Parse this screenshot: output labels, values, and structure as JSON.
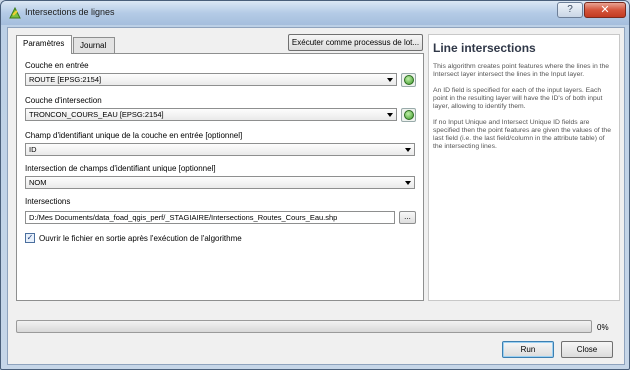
{
  "window": {
    "title": "Intersections de lignes",
    "help_glyph": "?",
    "close_glyph": "✕"
  },
  "tabs": [
    {
      "label": "Paramètres",
      "active": true
    },
    {
      "label": "Journal",
      "active": false
    }
  ],
  "toolbar": {
    "exec_batch_label": "Exécuter comme processus de lot..."
  },
  "params": {
    "input_layer": {
      "label": "Couche en entrée",
      "value": "ROUTE [EPSG:2154]"
    },
    "intersect_layer": {
      "label": "Couche d'intersection",
      "value": "TRONCON_COURS_EAU [EPSG:2154]"
    },
    "input_unique_id": {
      "label": "Champ d'identifiant unique de la couche en entrée [optionnel]",
      "value": "ID"
    },
    "intersect_unique_id": {
      "label": "Intersection de champs d'identifiant unique [optionnel]",
      "value": "NOM"
    },
    "output": {
      "label": "Intersections",
      "value": "D:/Mes Documents/data_foad_qgis_perf/_STAGIAIRE/Intersections_Routes_Cours_Eau.shp",
      "browse_label": "..."
    },
    "open_after": {
      "label": "Ouvrir le fichier en sortie après l'exécution de l'algorithme",
      "checked": true,
      "mark": "✓"
    }
  },
  "help": {
    "title": "Line intersections",
    "paragraphs": [
      "This algorithm creates point features where the lines in the Intersect layer intersect the lines in the Input layer.",
      "An ID field is specified for each of the input layers. Each point in the resulting layer will have the ID's of both input layer, allowing to identify them.",
      "If no Input Unique and Intersect Unique ID fields are specified then the point features are given the values of the last field (i.e. the last field/column in the attribute table) of the intersecting lines."
    ]
  },
  "progress": {
    "fraction": 0.0,
    "label": "0%"
  },
  "buttons": {
    "run_label": "Run",
    "close_label": "Close"
  },
  "colors": {
    "accent": "#3c7fb1",
    "close_red": "#c23b22",
    "progress_green": "#37b03a"
  }
}
